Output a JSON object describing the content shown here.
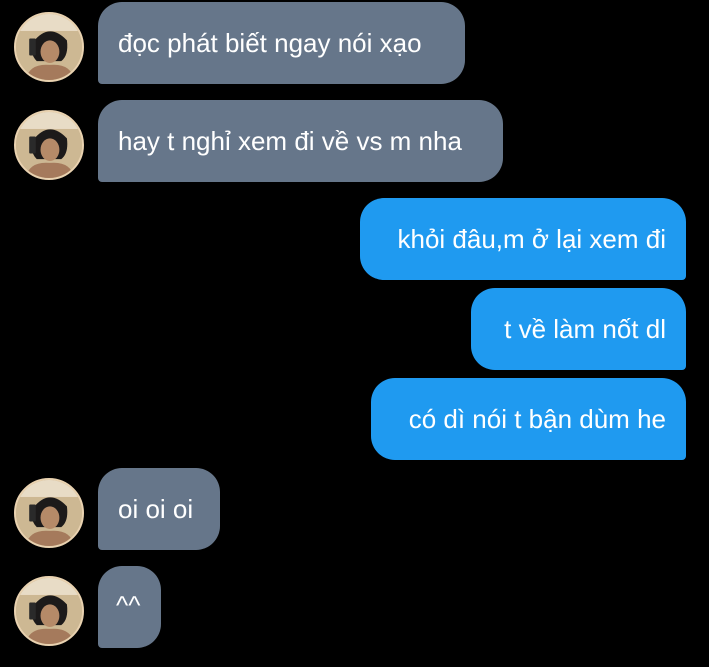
{
  "colors": {
    "background": "#000000",
    "incoming_bubble": "#66768a",
    "outgoing_bubble": "#1f9af0",
    "text": "#ffffff"
  },
  "contact": {
    "avatar_icon": "profile-photo"
  },
  "messages": [
    {
      "direction": "in",
      "text": "đọc phát biết ngay nói xạo"
    },
    {
      "direction": "in",
      "text": "hay t nghỉ xem đi về vs m nha"
    },
    {
      "direction": "out",
      "text": "khỏi đâu,m ở lại xem đi"
    },
    {
      "direction": "out",
      "text": "t về làm nốt dl"
    },
    {
      "direction": "out",
      "text": "có dì nói t bận dùm he"
    },
    {
      "direction": "in",
      "text": "oi oi oi"
    },
    {
      "direction": "in",
      "text": "^^"
    }
  ]
}
